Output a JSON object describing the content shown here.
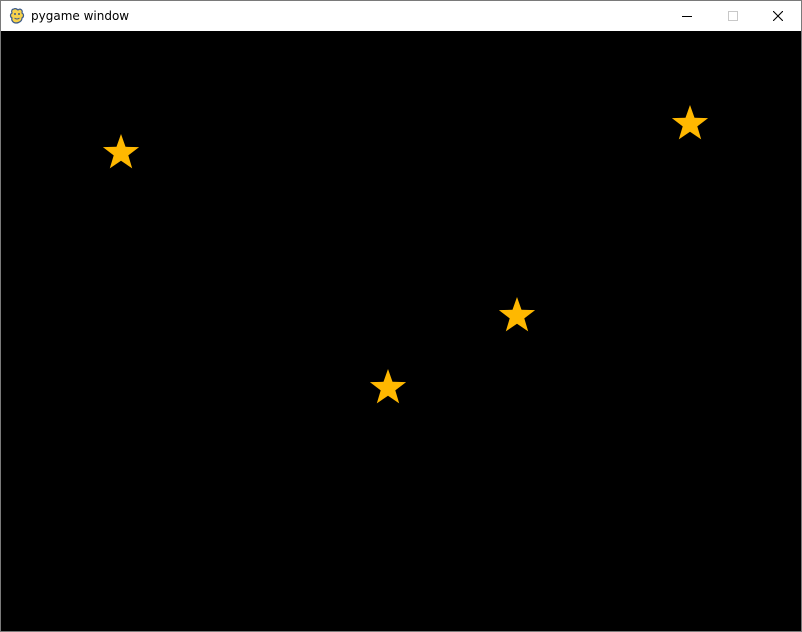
{
  "window": {
    "title": "pygame window",
    "app_icon": "pygame-snake-icon",
    "controls": {
      "minimize_icon": "minimize-icon",
      "maximize_icon": "maximize-icon",
      "close_icon": "close-icon"
    }
  },
  "scene": {
    "background_color": "#000000",
    "star_color": "#FFB800",
    "star_count": 4
  }
}
